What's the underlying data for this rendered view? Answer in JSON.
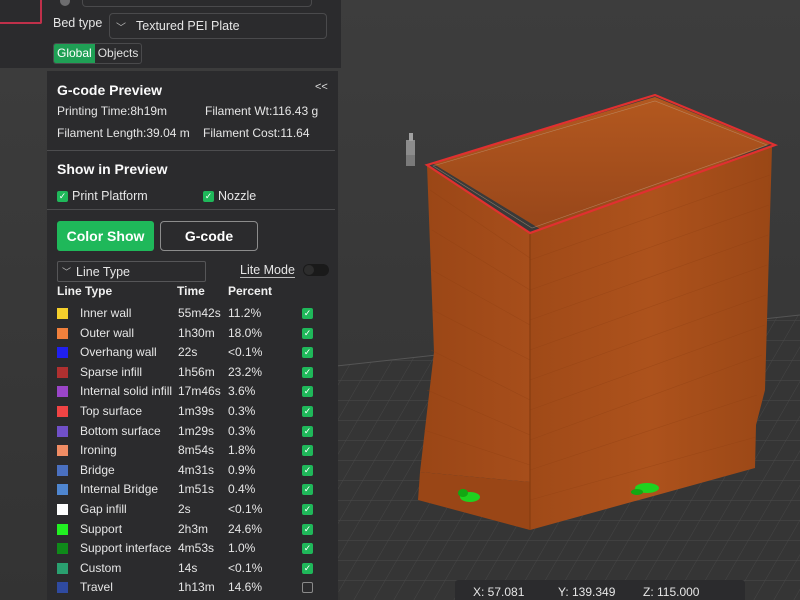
{
  "settings": {
    "bed_type_label": "Bed type",
    "bed_type_value": "Textured PEI Plate",
    "tabs": [
      {
        "label": "Global",
        "active": true
      },
      {
        "label": "Objects",
        "active": false
      }
    ]
  },
  "gcode_preview": {
    "title": "G-code Preview",
    "collapse": "<<",
    "printing_time": "Printing Time:8h19m",
    "filament_weight": "Filament Wt:116.43 g",
    "filament_length": "Filament Length:39.04 m",
    "filament_cost": "Filament Cost:11.64"
  },
  "show_in_preview": {
    "title": "Show in Preview",
    "print_platform": {
      "label": "Print Platform",
      "checked": true
    },
    "nozzle": {
      "label": "Nozzle",
      "checked": true
    }
  },
  "buttons": {
    "color_show": "Color Show",
    "gcode": "G-code"
  },
  "view_type": {
    "selected": "Line Type",
    "lite_mode": "Lite Mode",
    "lite_mode_on": false
  },
  "table": {
    "headers": {
      "line_type": "Line Type",
      "time": "Time",
      "percent": "Percent"
    },
    "rows": [
      {
        "name": "Inner wall",
        "time": "55m42s",
        "percent": "11.2%",
        "color": "#f5d02c",
        "checked": true
      },
      {
        "name": "Outer wall",
        "time": "1h30m",
        "percent": "18.0%",
        "color": "#f0803c",
        "checked": true
      },
      {
        "name": "Overhang wall",
        "time": "22s",
        "percent": "<0.1%",
        "color": "#2020f0",
        "checked": true
      },
      {
        "name": "Sparse infill",
        "time": "1h56m",
        "percent": "23.2%",
        "color": "#b03030",
        "checked": true
      },
      {
        "name": "Internal solid infill",
        "time": "17m46s",
        "percent": "3.6%",
        "color": "#9a45c8",
        "checked": true
      },
      {
        "name": "Top surface",
        "time": "1m39s",
        "percent": "0.3%",
        "color": "#f04444",
        "checked": true
      },
      {
        "name": "Bottom surface",
        "time": "1m29s",
        "percent": "0.3%",
        "color": "#7050c8",
        "checked": true
      },
      {
        "name": "Ironing",
        "time": "8m54s",
        "percent": "1.8%",
        "color": "#f08c64",
        "checked": true
      },
      {
        "name": "Bridge",
        "time": "4m31s",
        "percent": "0.9%",
        "color": "#4a70c0",
        "checked": true
      },
      {
        "name": "Internal Bridge",
        "time": "1m51s",
        "percent": "0.4%",
        "color": "#4f86d0",
        "checked": true
      },
      {
        "name": "Gap infill",
        "time": "2s",
        "percent": "<0.1%",
        "color": "#ffffff",
        "checked": true
      },
      {
        "name": "Support",
        "time": "2h3m",
        "percent": "24.6%",
        "color": "#22f022",
        "checked": true
      },
      {
        "name": "Support interface",
        "time": "4m53s",
        "percent": "1.0%",
        "color": "#0f8a1a",
        "checked": true
      },
      {
        "name": "Custom",
        "time": "14s",
        "percent": "<0.1%",
        "color": "#2aa070",
        "checked": true
      },
      {
        "name": "Travel",
        "time": "1h13m",
        "percent": "14.6%",
        "color": "#2f4aa0",
        "checked": false
      }
    ]
  },
  "coordinates": {
    "x": "X: 57.081",
    "y": "Y: 139.349",
    "z": "Z: 115.000"
  },
  "colors": {
    "accent": "#1fb85a",
    "model": "#a84e1c",
    "model_top_edge": "#e03030",
    "panel_bg": "#2b2b2d"
  }
}
